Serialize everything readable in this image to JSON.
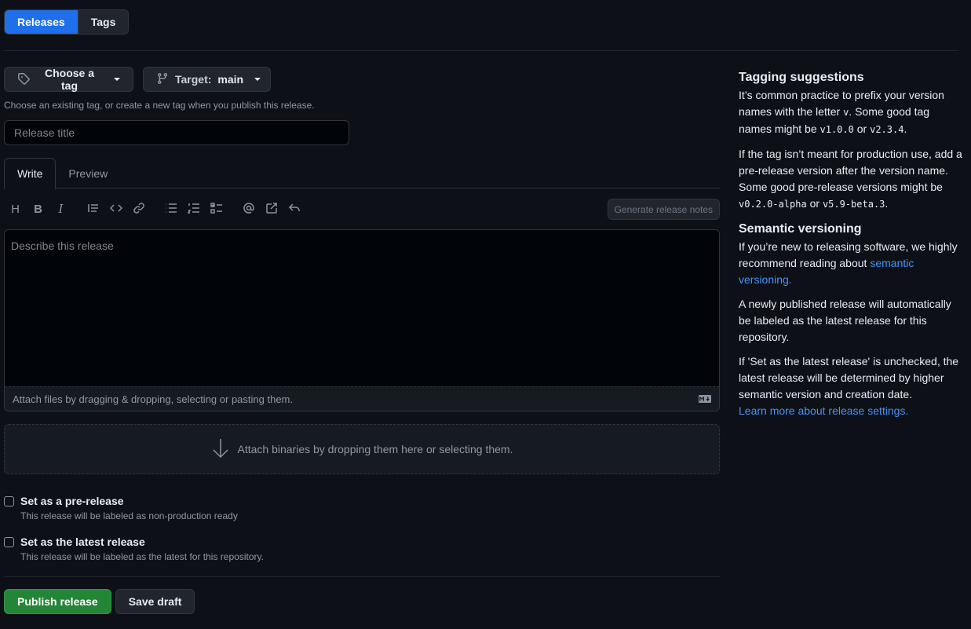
{
  "subnav": {
    "releases": "Releases",
    "tags": "Tags"
  },
  "tag_picker": {
    "label": "Choose a tag",
    "target_label": "Target:",
    "target_value": "main",
    "hint": "Choose an existing tag, or create a new tag when you publish this release."
  },
  "title_input": {
    "placeholder": "Release title"
  },
  "tabs": {
    "write": "Write",
    "preview": "Preview"
  },
  "toolbar": {
    "heading": "H",
    "bold": "B",
    "italic": "I",
    "generate_notes": "Generate release notes"
  },
  "editor": {
    "placeholder": "Describe this release",
    "footer_text": "Attach files by dragging & dropping, selecting or pasting them."
  },
  "binaries": {
    "text": "Attach binaries by dropping them here or selecting them."
  },
  "prerelease": {
    "title": "Set as a pre-release",
    "description": "This release will be labeled as non-production ready"
  },
  "latest": {
    "title": "Set as the latest release",
    "description": "This release will be labeled as the latest for this repository."
  },
  "actions": {
    "publish": "Publish release",
    "draft": "Save draft"
  },
  "sidebar": {
    "tagging_title": "Tagging suggestions",
    "tagging_p1_a": "It’s common practice to prefix your version names with the letter ",
    "tagging_p1_code1": "v",
    "tagging_p1_b": ". Some good tag names might be ",
    "tagging_p1_code2": "v1.0.0",
    "tagging_p1_c": " or ",
    "tagging_p1_code3": "v2.3.4",
    "tagging_p1_d": ".",
    "tagging_p2_a": "If the tag isn’t meant for production use, add a pre-release version after the version name. Some good pre-release versions might be ",
    "tagging_p2_code1": "v0.2.0-alpha",
    "tagging_p2_b": " or ",
    "tagging_p2_code2": "v5.9-beta.3",
    "tagging_p2_c": ".",
    "semver_title": "Semantic versioning",
    "semver_p1_a": "If you’re new to releasing software, we highly recommend reading about ",
    "semver_p1_link": "semantic versioning.",
    "semver_p2": "A newly published release will automatically be labeled as the latest release for this repository.",
    "semver_p3": "If 'Set as the latest release' is unchecked, the latest release will be determined by higher semantic version and creation date.",
    "semver_p3_link": "Learn more about release settings."
  }
}
